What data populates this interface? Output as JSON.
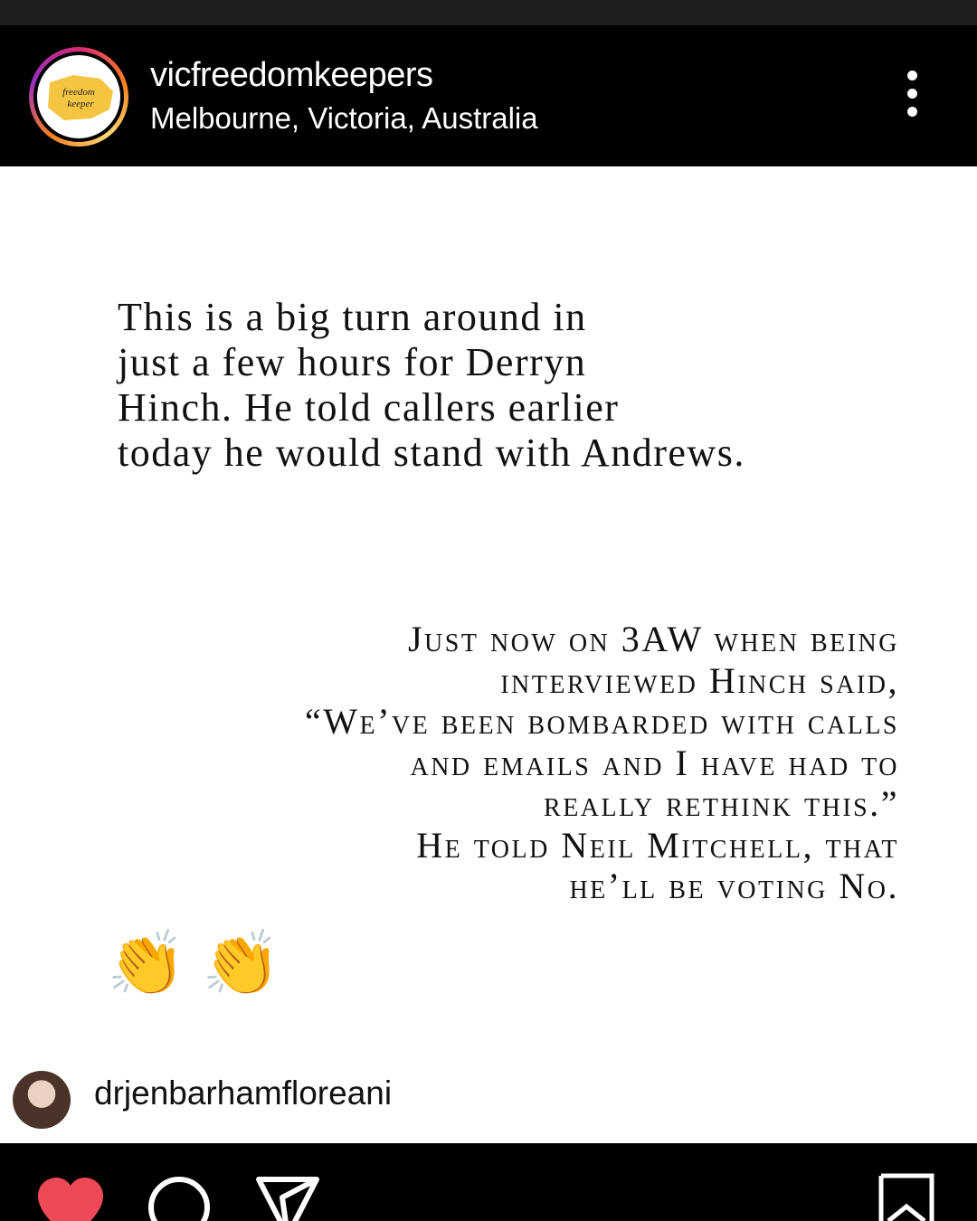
{
  "header": {
    "username": "vicfreedomkeepers",
    "location": "Melbourne, Victoria, Australia",
    "avatar_logo_text": "freedom keeper"
  },
  "post": {
    "paragraph_1": "This is a big turn around in\njust a few hours for Derryn\nHinch. He told callers earlier\ntoday he would stand with Andrews.",
    "paragraph_2": "Just now on 3AW when being\ninterviewed Hinch said,\n“We’ve been bombarded with calls\nand emails and I have had to\nreally rethink this.”\nHe told Neil Mitchell, that\nhe’ll be voting No.",
    "emojis": "👏👏",
    "credit_username": "drjenbarhamfloreani"
  },
  "colors": {
    "background": "#000000",
    "heart": "#ed4956",
    "avatar_map": "#f5c542"
  },
  "icons": [
    "more-vertical-icon",
    "heart-icon",
    "comment-icon",
    "share-icon",
    "save-icon"
  ]
}
